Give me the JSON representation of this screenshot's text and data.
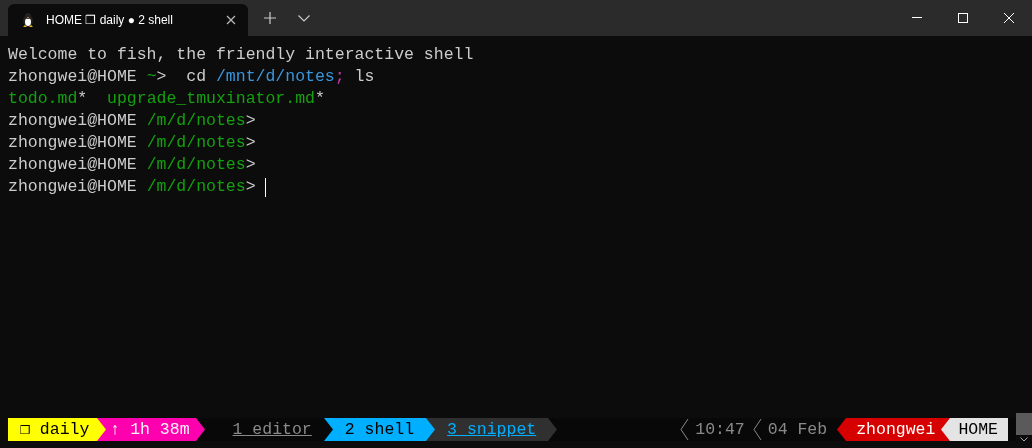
{
  "window": {
    "tab_title": "HOME ❒ daily ● 2 shell"
  },
  "terminal": {
    "lines": [
      [
        {
          "kind": "plain",
          "text": "Welcome to fish, the friendly interactive shell"
        }
      ],
      [
        {
          "kind": "plain",
          "text": "zhongwei@HOME "
        },
        {
          "kind": "path",
          "text": "~"
        },
        {
          "kind": "plain",
          "text": ">  cd "
        },
        {
          "kind": "arg",
          "text": "/mnt/d/notes"
        },
        {
          "kind": "sep",
          "text": ";"
        },
        {
          "kind": "plain",
          "text": " ls"
        }
      ],
      [
        {
          "kind": "file",
          "text": "todo.md"
        },
        {
          "kind": "plain",
          "text": "*  "
        },
        {
          "kind": "file",
          "text": "upgrade_tmuxinator.md"
        },
        {
          "kind": "plain",
          "text": "*"
        }
      ],
      [
        {
          "kind": "plain",
          "text": "zhongwei@HOME "
        },
        {
          "kind": "path",
          "text": "/m/d/notes"
        },
        {
          "kind": "plain",
          "text": ">"
        }
      ],
      [
        {
          "kind": "plain",
          "text": "zhongwei@HOME "
        },
        {
          "kind": "path",
          "text": "/m/d/notes"
        },
        {
          "kind": "plain",
          "text": ">"
        }
      ],
      [
        {
          "kind": "plain",
          "text": "zhongwei@HOME "
        },
        {
          "kind": "path",
          "text": "/m/d/notes"
        },
        {
          "kind": "plain",
          "text": ">"
        }
      ],
      [
        {
          "kind": "plain",
          "text": "zhongwei@HOME "
        },
        {
          "kind": "path",
          "text": "/m/d/notes"
        },
        {
          "kind": "plain",
          "text": "> "
        }
      ]
    ]
  },
  "status_bar": {
    "session": "❒ daily",
    "uptime": "↑ 1h 38m",
    "windows": [
      {
        "label": "1 editor",
        "selected": false,
        "last": false
      },
      {
        "label": "2 shell",
        "selected": true,
        "last": false
      },
      {
        "label": "3 snippet",
        "selected": false,
        "last": true
      }
    ],
    "time": "10:47",
    "date": "04 Feb",
    "user": "zhongwei",
    "host": "HOME"
  }
}
